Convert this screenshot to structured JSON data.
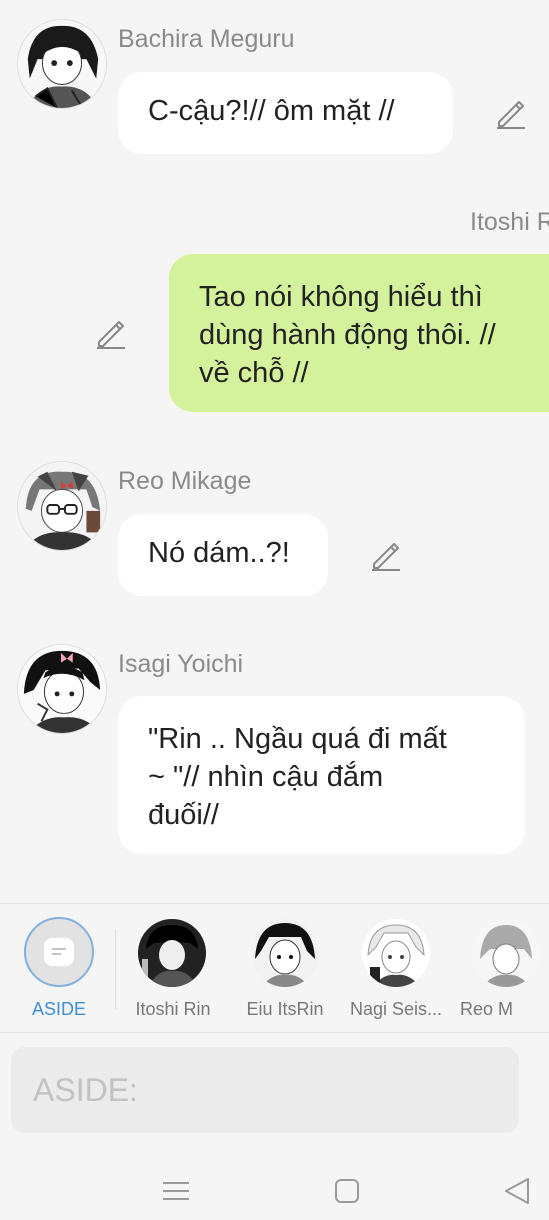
{
  "messages": [
    {
      "sender": "Bachira Meguru",
      "text": "C-cậu?!// ôm mặt //",
      "mine": false
    },
    {
      "sender": "Itoshi R",
      "text_lines": [
        "Tao nói không hiểu thì",
        "dùng hành động thôi. //",
        "về chỗ //"
      ],
      "mine": true
    },
    {
      "sender": "Reo Mikage",
      "text": "Nó dám..?!",
      "mine": false
    },
    {
      "sender": "Isagi Yoichi",
      "text_lines": [
        "\"Rin .. Ngầu quá đi mất",
        "~ \"// nhìn cậu đắm",
        "đuối//"
      ],
      "mine": false
    }
  ],
  "character_bar": {
    "items": [
      {
        "label": "ASIDE",
        "selected": true
      },
      {
        "label": "Itoshi Rin"
      },
      {
        "label": "Eiu ItsRin"
      },
      {
        "label": "Nagi Seis..."
      },
      {
        "label": "Reo M"
      }
    ]
  },
  "input": {
    "placeholder": "ASIDE:"
  },
  "icons": {
    "edit": "pencil-icon",
    "nav_menu": "menu-icon",
    "nav_home": "home-square-icon",
    "nav_back": "back-triangle-icon"
  },
  "colors": {
    "mine_bubble": "#d4f29b",
    "other_bubble": "#ffffff",
    "accent": "#3d8fd4",
    "background": "#f5f5f5"
  }
}
